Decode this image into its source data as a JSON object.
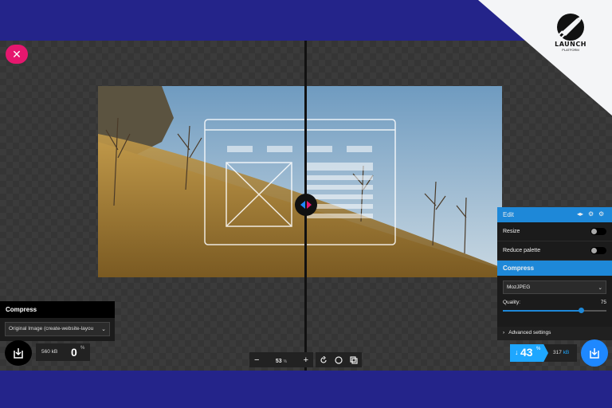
{
  "app": {
    "brand": "LAUNCH",
    "brand_sub": "PLATFORM",
    "close_icon": "close-icon",
    "accent": "#1e88d8",
    "close_color": "#e6176e"
  },
  "left_panel": {
    "header": "Compress",
    "selected_format": "Original Image (create-website-layou",
    "file_size": "560 kB",
    "percent": "0",
    "percent_sign": "%"
  },
  "zoom": {
    "minus": "−",
    "value": "53",
    "percent_sign": "%",
    "plus": "+"
  },
  "right_panel": {
    "edit_header": "Edit",
    "resize_label": "Resize",
    "reduce_palette_label": "Reduce palette",
    "compress_header": "Compress",
    "format": "MozJPEG",
    "quality_label": "Quality:",
    "quality_value": "75",
    "quality_fraction": 0.75,
    "advanced_label": "Advanced settings",
    "saved_arrow": "↓",
    "saved_percent": "43",
    "saved_sign": "%",
    "result_size": "317",
    "result_unit": "kB"
  }
}
